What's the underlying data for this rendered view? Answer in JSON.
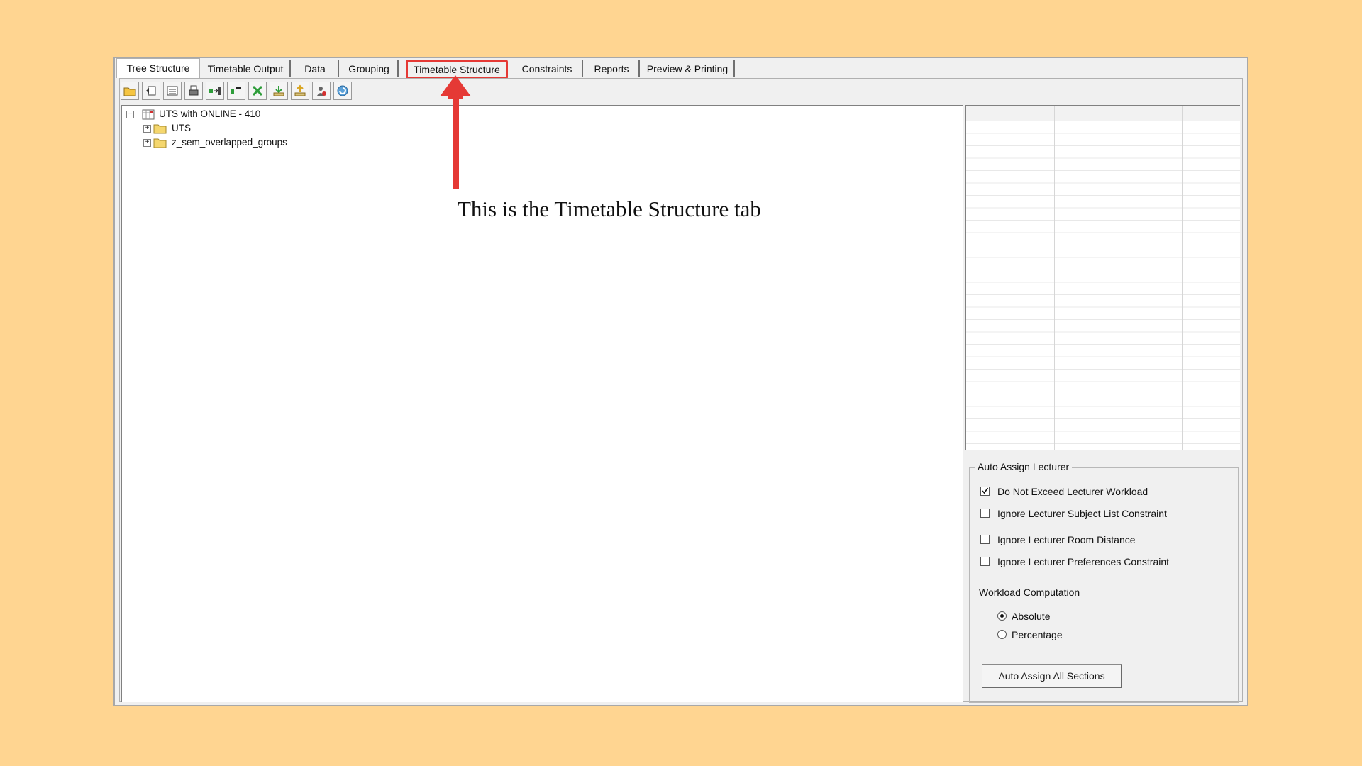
{
  "tabs": [
    {
      "label": "Tree Structure"
    },
    {
      "label": "Timetable Output"
    },
    {
      "label": "Data"
    },
    {
      "label": "Grouping"
    },
    {
      "label": "Timetable Structure"
    },
    {
      "label": "Constraints"
    },
    {
      "label": "Reports"
    },
    {
      "label": "Preview & Printing"
    }
  ],
  "toolbar": {
    "icons": [
      "open-folder-icon",
      "undo-icon",
      "calendar-list-icon",
      "print-icon",
      "export-icon",
      "collapse-icon",
      "delete-icon",
      "download-icon",
      "upload-icon",
      "user-alert-icon",
      "refresh-icon"
    ]
  },
  "tree": {
    "root": "UTS with ONLINE - 410",
    "children": [
      "UTS",
      "z_sem_overlapped_groups"
    ]
  },
  "auto_assign": {
    "title": "Auto Assign Lecturer",
    "checks": [
      {
        "label": "Do Not Exceed Lecturer Workload",
        "checked": true
      },
      {
        "label": "Ignore Lecturer Subject List Constraint",
        "checked": false
      },
      {
        "label": "Ignore Lecturer Room Distance",
        "checked": false
      },
      {
        "label": "Ignore Lecturer Preferences Constraint",
        "checked": false
      }
    ],
    "workload_label": "Workload Computation",
    "radios": [
      {
        "label": "Absolute",
        "selected": true
      },
      {
        "label": "Percentage",
        "selected": false
      }
    ],
    "button_label": "Auto Assign All Sections"
  },
  "annotation": {
    "text": "This is the Timetable Structure tab",
    "arrow_color": "#E53935"
  },
  "colors": {
    "background": "#FFD591",
    "highlight": "#E53935"
  }
}
